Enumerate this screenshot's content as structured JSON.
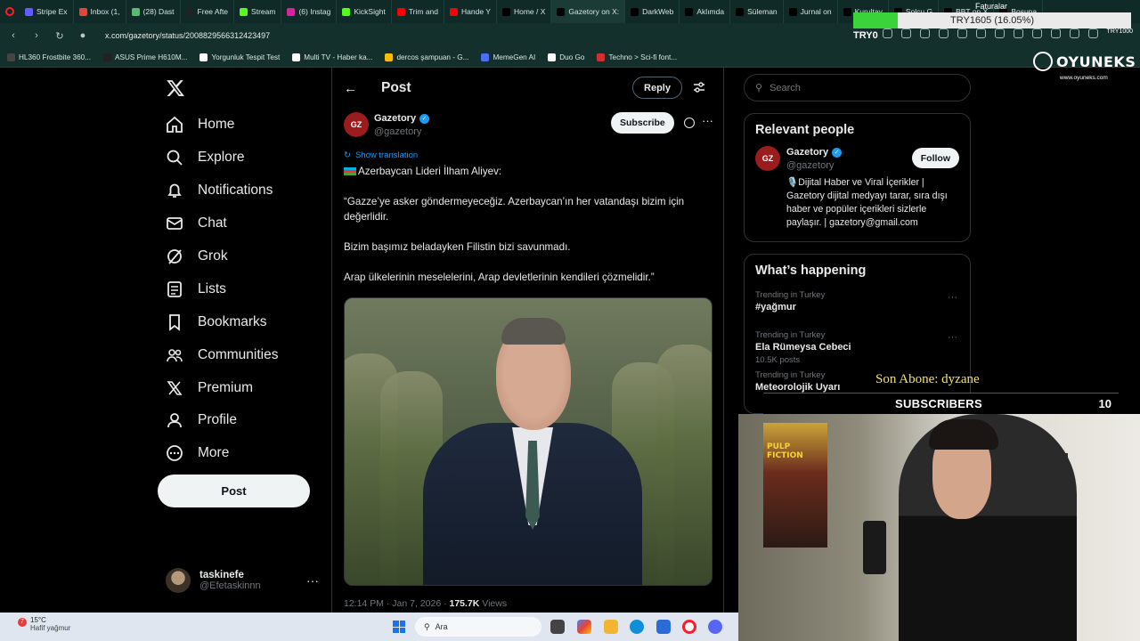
{
  "browser": {
    "tabs": [
      {
        "label": "Stripe Ex",
        "color": "#635bff"
      },
      {
        "label": "Inbox (1,",
        "color": "#ea4335"
      },
      {
        "label": "(28) Dast",
        "color": "#5bb974"
      },
      {
        "label": "Free Afte",
        "color": "#222222"
      },
      {
        "label": "Stream",
        "color": "#53fc18"
      },
      {
        "label": "(6) Instag",
        "color": "#d6249f"
      },
      {
        "label": "KickSight",
        "color": "#53fc18"
      },
      {
        "label": "Trim and",
        "color": "#ff0000"
      },
      {
        "label": "Hande Y",
        "color": "#ff0000"
      },
      {
        "label": "Home / X",
        "color": "#000000"
      },
      {
        "label": "Gazetory on X:",
        "color": "#000000"
      },
      {
        "label": "DarkWeb",
        "color": "#000000"
      },
      {
        "label": "Aklımda",
        "color": "#000000"
      },
      {
        "label": "Süleman",
        "color": "#000000"
      },
      {
        "label": "Jurnal on",
        "color": "#000000"
      },
      {
        "label": "Kurultay",
        "color": "#000000"
      },
      {
        "label": "Solcu G",
        "color": "#000000"
      },
      {
        "label": "BBT on X",
        "color": "#000000"
      },
      {
        "label": "Bosuna",
        "color": "#000000"
      }
    ],
    "active_tab": "Gazetory on X:",
    "url": "x.com/gazetory/status/2008829566312423497",
    "bookmarks": [
      {
        "label": "HL360 Frostbite 360...",
        "color": "#444444"
      },
      {
        "label": "ASUS Prime H610M...",
        "color": "#222222"
      },
      {
        "label": "Yorgunluk Tespit Test",
        "color": "#ffffff"
      },
      {
        "label": "Multi TV - Haber ka...",
        "color": "#ffffff"
      },
      {
        "label": "dercos şampuan - G...",
        "color": "#fbbc05"
      },
      {
        "label": "MemeGen AI",
        "color": "#4c6ef5"
      },
      {
        "label": "Duo Go",
        "color": "#ffffff"
      },
      {
        "label": "Techno > Sci-fi font...",
        "color": "#d32f2f"
      }
    ],
    "extension_label": "TRY1000"
  },
  "widgets": {
    "fatura": "Faturalar",
    "try_progress_label": "TRY1605 (16.05%)",
    "try_progress_fraction": 0.1605,
    "try_small": "TRY0"
  },
  "sidebar": {
    "items": [
      {
        "label": "Home",
        "icon": "home-icon"
      },
      {
        "label": "Explore",
        "icon": "search-icon"
      },
      {
        "label": "Notifications",
        "icon": "bell-icon"
      },
      {
        "label": "Chat",
        "icon": "mail-icon"
      },
      {
        "label": "Grok",
        "icon": "grok-icon"
      },
      {
        "label": "Lists",
        "icon": "list-icon"
      },
      {
        "label": "Bookmarks",
        "icon": "bookmark-icon"
      },
      {
        "label": "Communities",
        "icon": "people-icon"
      },
      {
        "label": "Premium",
        "icon": "x-icon"
      },
      {
        "label": "Profile",
        "icon": "person-icon"
      },
      {
        "label": "More",
        "icon": "more-circle-icon"
      }
    ],
    "post_button": "Post",
    "user": {
      "name": "taskinefe",
      "handle": "@Efetaskinnn"
    }
  },
  "post": {
    "header_title": "Post",
    "reply_label": "Reply",
    "author_name": "Gazetory",
    "author_handle": "@gazetory",
    "avatar_text": "GZ",
    "subscribe_label": "Subscribe",
    "show_translation": "Show translation",
    "lines": [
      "Azerbaycan Lideri İlham Aliyev:",
      "“Gazze’ye asker göndermeyeceğiz. Azerbaycan’ın her vatandaşı bizim için değerlidir.",
      "Bizim başımız beladayken Filistin bizi savunmadı.",
      "Arap ülkelerinin meselelerini, Arap devletlerinin kendileri çözmelidir.”"
    ],
    "time": "12:14 PM · Jan 7, 2026 · ",
    "views_count": "175.7K",
    "views_label": " Views"
  },
  "right": {
    "search_placeholder": "Search",
    "relevant_title": "Relevant people",
    "rp_name": "Gazetory",
    "rp_handle": "@gazetory",
    "follow_label": "Follow",
    "rp_bio": "🎙️Dijital Haber ve Viral İçerikler | Gazetory dijital medyayı tarar, sıra dışı haber ve popüler içerikleri sizlerle paylaşır. | gazetory@gmail.com",
    "happening_title": "What’s happening",
    "trends": [
      {
        "context": "Trending in Turkey",
        "title": "#yağmur",
        "posts": ""
      },
      {
        "context": "Trending in Turkey",
        "title": "Ela Rümeysa Cebeci",
        "posts": "10.5K posts"
      },
      {
        "context": "Trending in Turkey",
        "title": "Meteorolojik Uyarı",
        "posts": ""
      }
    ]
  },
  "overlay": {
    "brand": "OYUNEKS",
    "brand_sub": "www.oyuneks.com",
    "son_abone": "Son Abone: dyzane",
    "subscribers_label": "SUBSCRIBERS",
    "subscribers_count": "10",
    "poster_text": "PULP FICTION"
  },
  "taskbar": {
    "temp": "15°C",
    "weather_desc": "Hafif yağmur",
    "weather_badge": "7",
    "search_placeholder": "Ara"
  }
}
